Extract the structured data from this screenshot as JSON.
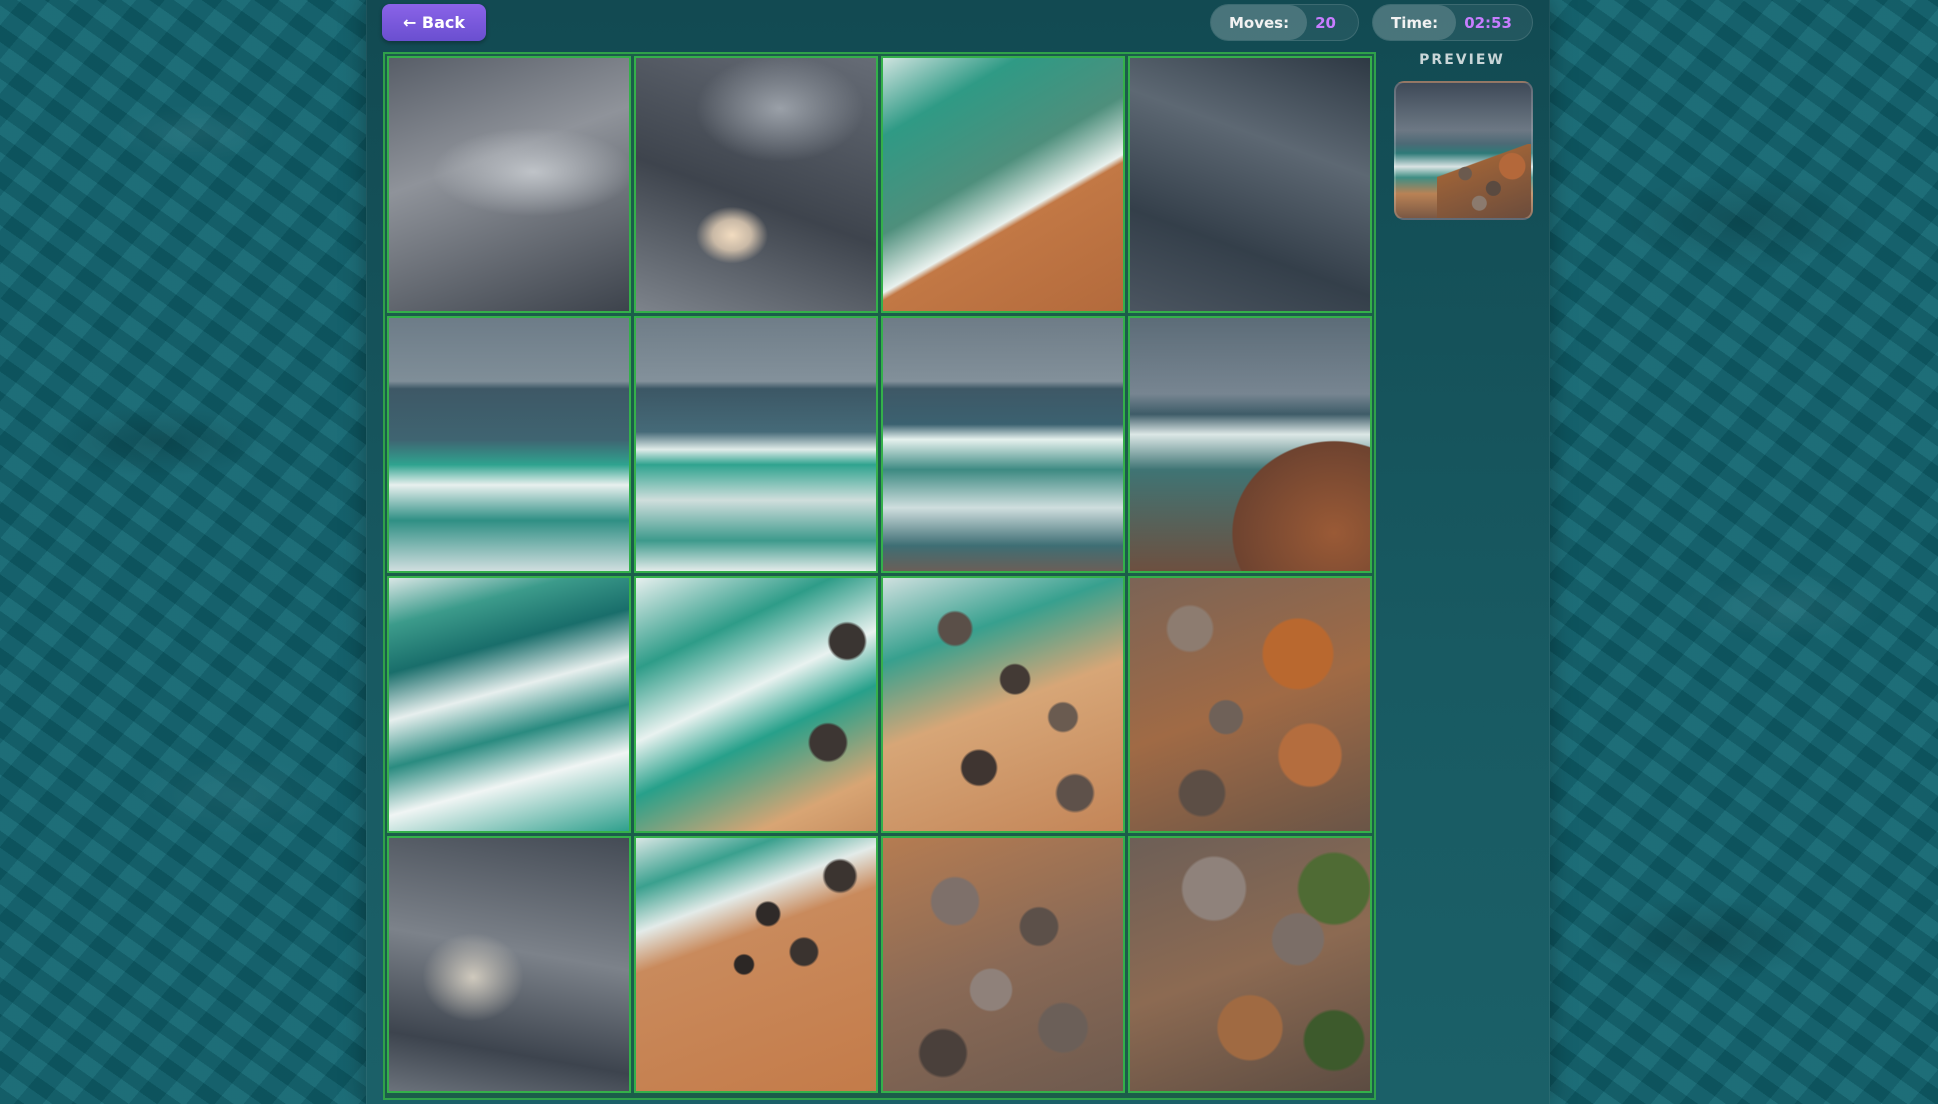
{
  "header": {
    "back_label": "← Back",
    "moves_label": "Moves:",
    "moves_value": "20",
    "time_label": "Time:",
    "time_value": "02:53"
  },
  "preview": {
    "label": "PREVIEW"
  },
  "board": {
    "rows": 4,
    "cols": 4,
    "tiles": [
      {
        "row": 0,
        "col": 0,
        "piece": "cloud-sky-1"
      },
      {
        "row": 0,
        "col": 1,
        "piece": "cloud-sky-sun"
      },
      {
        "row": 0,
        "col": 2,
        "piece": "surf-beach"
      },
      {
        "row": 0,
        "col": 3,
        "piece": "cloud-sky-dark"
      },
      {
        "row": 1,
        "col": 0,
        "piece": "sea-horizon-left"
      },
      {
        "row": 1,
        "col": 1,
        "piece": "sea-horizon-mid"
      },
      {
        "row": 1,
        "col": 2,
        "piece": "sea-horizon-right"
      },
      {
        "row": 1,
        "col": 3,
        "piece": "cliff-horizon"
      },
      {
        "row": 2,
        "col": 0,
        "piece": "waves-left"
      },
      {
        "row": 2,
        "col": 1,
        "piece": "waves-rocks"
      },
      {
        "row": 2,
        "col": 2,
        "piece": "shore-rocks"
      },
      {
        "row": 2,
        "col": 3,
        "piece": "cliff-rocks"
      },
      {
        "row": 3,
        "col": 0,
        "piece": "cloud-sky-2"
      },
      {
        "row": 3,
        "col": 1,
        "piece": "beach-pebbles"
      },
      {
        "row": 3,
        "col": 2,
        "piece": "rocks-sand"
      },
      {
        "row": 3,
        "col": 3,
        "piece": "rocks-moss"
      }
    ]
  },
  "colors": {
    "accent_button": "#7b5ae0",
    "stat_value": "#c77dff",
    "tile_border": "#34b04a",
    "background": "#0f6470"
  }
}
